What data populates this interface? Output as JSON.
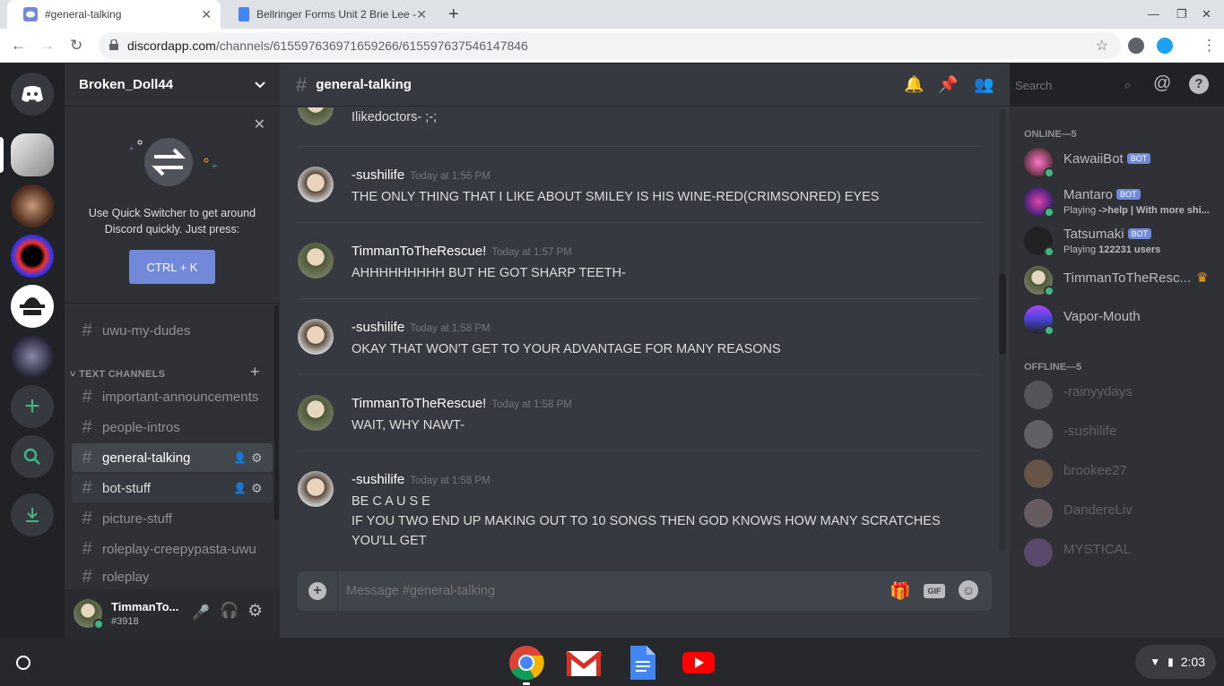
{
  "browser": {
    "tabs": [
      {
        "title": "#general-talking"
      },
      {
        "title": "Bellringer Forms Unit 2 Brie Lee -"
      }
    ],
    "url_host": "discordapp.com",
    "url_path": "/channels/615597636971659266/615597637546147846"
  },
  "server": {
    "name": "Broken_Doll44"
  },
  "quick_switcher": {
    "text": "Use Quick Switcher to get around Discord quickly. Just press:",
    "shortcut": "CTRL + K"
  },
  "channels": {
    "top": "uwu-my-dudes",
    "category": "TEXT CHANNELS",
    "items": [
      "important-announcements",
      "people-intros",
      "general-talking",
      "bot-stuff",
      "picture-stuff",
      "roleplay-creepypasta-uwu",
      "roleplay"
    ]
  },
  "user": {
    "name": "TimmanTo...",
    "tag": "#3918"
  },
  "chat": {
    "channel": "general-talking",
    "search_placeholder": "Search",
    "composer_placeholder": "Message #general-talking",
    "partial_text": "Ilikedoctors- ;-;",
    "messages": [
      {
        "author": "-sushilife",
        "time": "Today at 1:56 PM",
        "lines": [
          "THE ONLY THING THAT I LIKE ABOUT SMILEY IS HIS WINE-RED(CRIMSONRED) EYES"
        ]
      },
      {
        "author": "TimmanToTheRescue!",
        "time": "Today at 1:57 PM",
        "lines": [
          "AHHHHHHHHH BUT HE GOT SHARP TEETH-"
        ]
      },
      {
        "author": "-sushilife",
        "time": "Today at 1:58 PM",
        "lines": [
          "OKAY THAT WON'T GET TO YOUR ADVANTAGE FOR MANY REASONS"
        ]
      },
      {
        "author": "TimmanToTheRescue!",
        "time": "Today at 1:58 PM",
        "lines": [
          "WAIT, WHY NAWT-"
        ]
      },
      {
        "author": "-sushilife",
        "time": "Today at 1:58 PM",
        "lines": [
          "BE C A U S E",
          "IF YOU TWO END UP MAKING OUT TO 10 SONGS THEN GOD KNOWS HOW MANY SCRATCHES YOU'LL GET"
        ]
      }
    ]
  },
  "members": {
    "online_header": "ONLINE—5",
    "offline_header": "OFFLINE—5",
    "bot_label": "BOT",
    "online": [
      {
        "name": "KawaiiBot",
        "bot": true,
        "status": ""
      },
      {
        "name": "Mantaro",
        "bot": true,
        "status_pre": "Playing ",
        "status_bold": "->help | With more shi..."
      },
      {
        "name": "Tatsumaki",
        "bot": true,
        "status_pre": "Playing ",
        "status_bold": "122231 users"
      },
      {
        "name": "TimmanToTheResc...",
        "bot": false,
        "crown": true
      },
      {
        "name": "Vapor-Mouth",
        "bot": false
      }
    ],
    "offline": [
      "-rainyydays",
      "-sushilife",
      "brookee27",
      "DandereLiv",
      "MYSTICAL"
    ]
  },
  "shelf": {
    "time": "2:03"
  },
  "colors": {
    "blurple": "#7289da",
    "online": "#43b581",
    "chat_bg": "#36393f"
  }
}
